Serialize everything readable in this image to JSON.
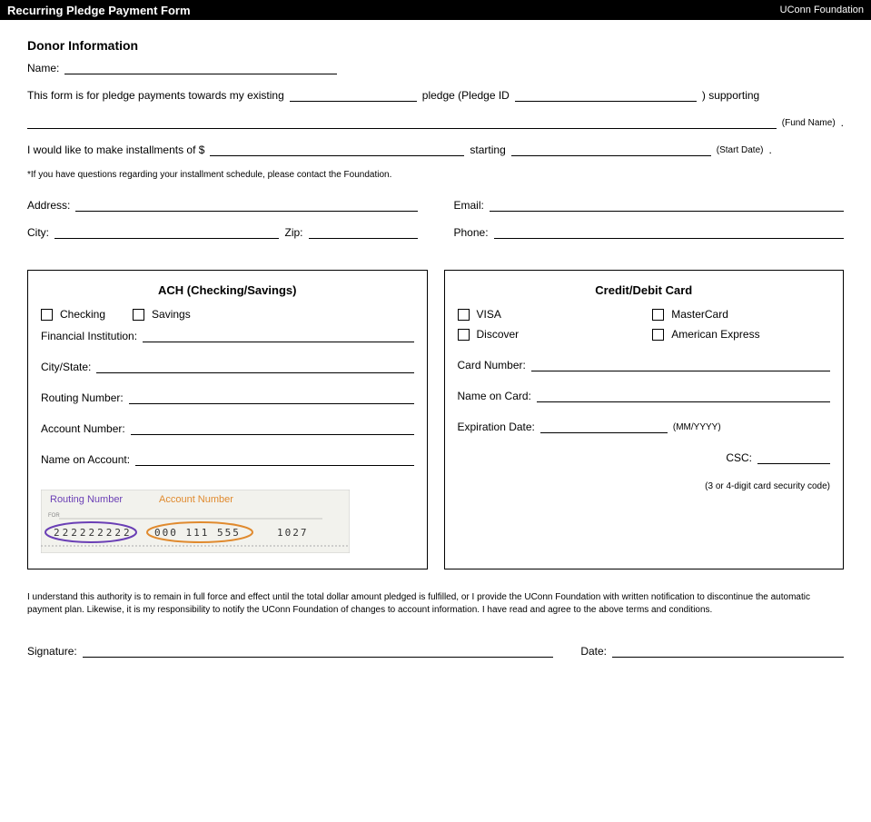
{
  "header": {
    "title": "Recurring Pledge Payment Form",
    "subtitle": "UConn Foundation"
  },
  "donor": {
    "heading": "Donor Information",
    "name_label": "Name:",
    "address_label": "Address:",
    "city_label": "City:",
    "zip_label": "Zip:",
    "pledge_sentence_1": "This form is for pledge payments towards my existing",
    "pledge_id_label": " pledge (Pledge ID",
    "pledge_sentence_2": ") supporting",
    "fund_name_label": "(Fund Name)",
    "period": ".",
    "gift_sentence_1": "I would like to make installments of $",
    "gift_sentence_2": "starting",
    "start_label": "(Start Date)",
    "installment_note": "*If you have questions regarding your installment schedule, please contact the Foundation.",
    "email_label": "Email:",
    "phone_label": "Phone:"
  },
  "ach": {
    "title": "ACH (Checking/Savings)",
    "checking": "Checking",
    "savings": "Savings",
    "financial_inst": "Financial Institution:",
    "city_state": "City/State:",
    "routing": "Routing Number:",
    "account": "Account Number:",
    "name": "Name on Account:",
    "img_routing": "Routing Number",
    "img_account": "Account Number",
    "img_for": "FOR",
    "img_routing_digits": "222222222",
    "img_account_digits": "000  111  555",
    "img_check_no": "1027"
  },
  "card": {
    "title": "Credit/Debit Card",
    "visa": "VISA",
    "mastercard": "MasterCard",
    "discover": "Discover",
    "amex": "American Express",
    "card_number": "Card Number:",
    "name": "Name on Card:",
    "exp": "Expiration Date:",
    "exp_hint": "(MM/YYYY)",
    "csc": "CSC:",
    "csc_note": "(3 or 4-digit card security code)"
  },
  "consent_text": "I understand this authority is to remain in full force and effect until the total dollar amount pledged is fulfilled, or I provide the UConn Foundation with written notification to discontinue the automatic payment plan. Likewise, it is my responsibility to notify the UConn Foundation of changes to account information. I have read and agree to the above terms and conditions.",
  "signature_label": "Signature:",
  "date_label": "Date:"
}
